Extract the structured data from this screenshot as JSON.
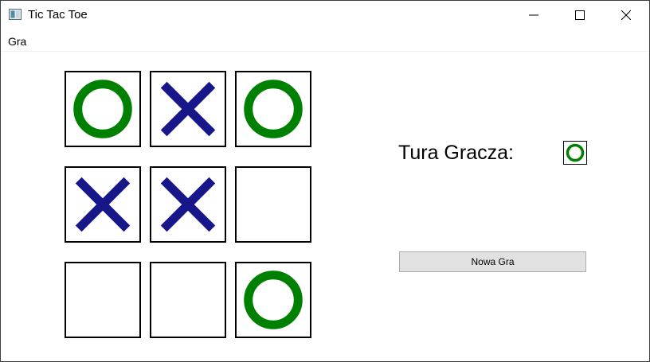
{
  "window": {
    "title": "Tic Tac Toe"
  },
  "menu": {
    "items": [
      "Gra"
    ]
  },
  "board": {
    "cells": [
      "O",
      "X",
      "O",
      "X",
      "X",
      "",
      "",
      "",
      "O"
    ]
  },
  "status": {
    "label": "Tura Gracza:",
    "current_player": "O"
  },
  "controls": {
    "new_game_label": "Nowa Gra"
  },
  "colors": {
    "x": "#17178a",
    "o": "#008000",
    "border": "#000000",
    "button_bg": "#e1e1e1"
  },
  "icons": {
    "minimize": "minimize-icon",
    "maximize": "maximize-icon",
    "close": "close-icon",
    "app": "app-window-icon"
  }
}
